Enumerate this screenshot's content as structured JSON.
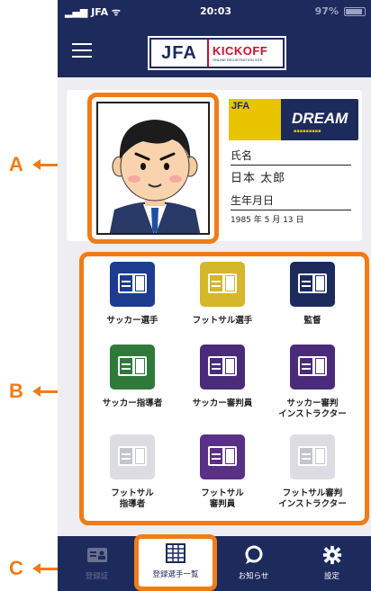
{
  "status_bar": {
    "carrier": "JFA",
    "time": "20:03",
    "battery": "97%"
  },
  "header": {
    "logo_main": "JFA",
    "logo_brand": "KICKOFF",
    "logo_tagline": "ONLINE REGISTRATION SITE"
  },
  "profile": {
    "badge_text": "DREAM",
    "badge_crest": "JFA",
    "name_label": "氏名",
    "name_value": "日本 太郎",
    "dob_label": "生年月日",
    "dob_value": "1985 年 5 月 13 日"
  },
  "licenses": [
    {
      "label": "サッカー選手",
      "color": "#1d3c8f"
    },
    {
      "label": "フットサル選手",
      "color": "#d4b72a"
    },
    {
      "label": "監督",
      "color": "#1d2a5c"
    },
    {
      "label": "サッカー指導者",
      "color": "#2f7a3a"
    },
    {
      "label": "サッカー審判員",
      "color": "#4a2b7a"
    },
    {
      "label": "サッカー審判\nインストラクター",
      "color": "#4a2b7a"
    },
    {
      "label": "フットサル\n指導者",
      "color": "#dcdce2"
    },
    {
      "label": "フットサル\n審判員",
      "color": "#5a2f86"
    },
    {
      "label": "フットサル審判\nインストラクター",
      "color": "#dcdce2"
    }
  ],
  "tabs": [
    {
      "label": "登録証",
      "icon": "id-card-icon"
    },
    {
      "label": "登録選手一覧",
      "icon": "list-grid-icon"
    },
    {
      "label": "お知らせ",
      "icon": "chat-bubble-icon"
    },
    {
      "label": "設定",
      "icon": "gear-icon"
    }
  ],
  "annotations": {
    "a": "A",
    "b": "B",
    "c": "C"
  },
  "colors": {
    "navy": "#1d2a5c",
    "accent": "#f07c17",
    "brand_red": "#c8102e"
  }
}
